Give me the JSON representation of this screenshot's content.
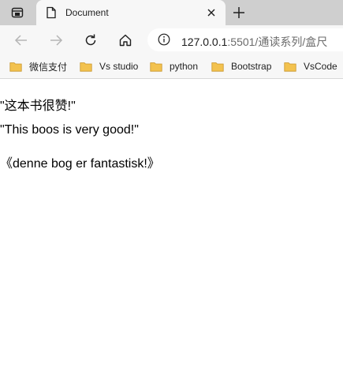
{
  "browser": {
    "tab": {
      "title": "Document"
    },
    "address": {
      "host": "127.0.0.1",
      "rest": ":5501/通读系列/盒尺"
    },
    "bookmarks": [
      {
        "label": "微信支付"
      },
      {
        "label": "Vs studio"
      },
      {
        "label": "python"
      },
      {
        "label": "Bootstrap"
      },
      {
        "label": "VsCode"
      }
    ]
  },
  "content": {
    "lines": [
      "\"这本书很赞!\"",
      "\"This boos is very good!\"",
      "《denne bog er fantastisk!》"
    ]
  },
  "colors": {
    "tabstrip": "#cfcfcf",
    "toolbar": "#f7f7f7",
    "folder": "#f3c24f"
  }
}
